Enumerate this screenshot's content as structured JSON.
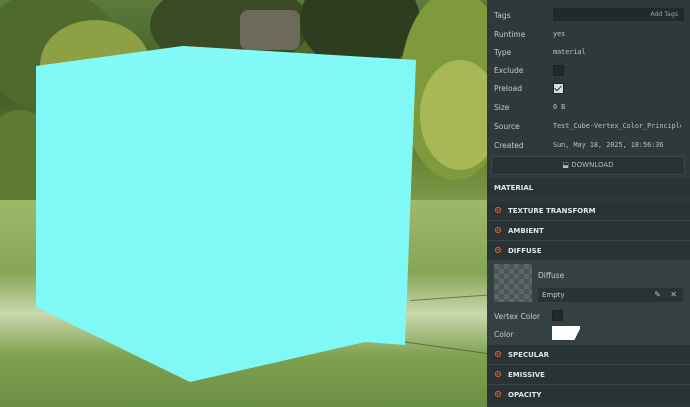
{
  "properties": {
    "tags": {
      "label": "Tags",
      "add_button": "Add Tags"
    },
    "runtime": {
      "label": "Runtime",
      "value": "yes"
    },
    "type": {
      "label": "Type",
      "value": "material"
    },
    "exclude": {
      "label": "Exclude",
      "checked": false
    },
    "preload": {
      "label": "Preload",
      "checked": true
    },
    "size": {
      "label": "Size",
      "value": "0 B"
    },
    "source": {
      "label": "Source",
      "value": "Test_Cube-Vertex_Color_Principled_"
    },
    "created": {
      "label": "Created",
      "value": "Sun, May 18, 2025, 18:56:36"
    }
  },
  "download": {
    "label": "DOWNLOAD",
    "icon": "download-icon"
  },
  "sections": {
    "material": "MATERIAL",
    "texture_transform": "TEXTURE TRANSFORM",
    "ambient": "AMBIENT",
    "diffuse": "DIFFUSE",
    "specular": "SPECULAR",
    "emissive": "EMISSIVE",
    "opacity": "OPACITY"
  },
  "diffuse": {
    "texture_label": "Diffuse",
    "texture_value": "Empty",
    "vertex_color_label": "Vertex Color",
    "vertex_color_checked": false,
    "color_label": "Color",
    "color": "#ffffff"
  },
  "viewport": {
    "cube_color": "#7ff8f6"
  },
  "colors": {
    "accent": "#f06a2c",
    "panel_bg": "#2f393c"
  }
}
